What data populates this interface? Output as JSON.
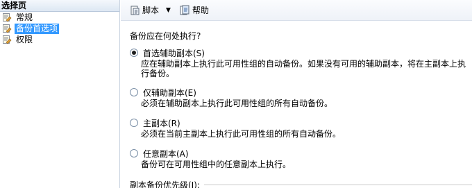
{
  "sidebar": {
    "title": "选择页",
    "items": [
      {
        "label": "常规",
        "icon": "page-icon",
        "selected": false
      },
      {
        "label": "备份首选项",
        "icon": "page-icon",
        "selected": true
      },
      {
        "label": "权限",
        "icon": "page-icon",
        "selected": false
      }
    ]
  },
  "toolbar": {
    "script_label": "脚本",
    "help_label": "帮助"
  },
  "main": {
    "question": "备份应在何处执行?",
    "options": [
      {
        "label": "首选辅助副本(S)",
        "description": "应在辅助副本上执行此可用性组的自动备份。如果没有可用的辅助副本，将在主副本上执行备份。",
        "checked": true
      },
      {
        "label": "仅辅助副本(E)",
        "description": "必须在辅助副本上执行此可用性组的所有自动备份。",
        "checked": false
      },
      {
        "label": "主副本(R)",
        "description": "必须在当前主副本上执行此可用性组的所有自动备份。",
        "checked": false
      },
      {
        "label": "任意副本(A)",
        "description": "备份可在可用性组中的任意副本上执行。",
        "checked": false
      }
    ],
    "priority_label": "副本备份优先级(I):"
  }
}
